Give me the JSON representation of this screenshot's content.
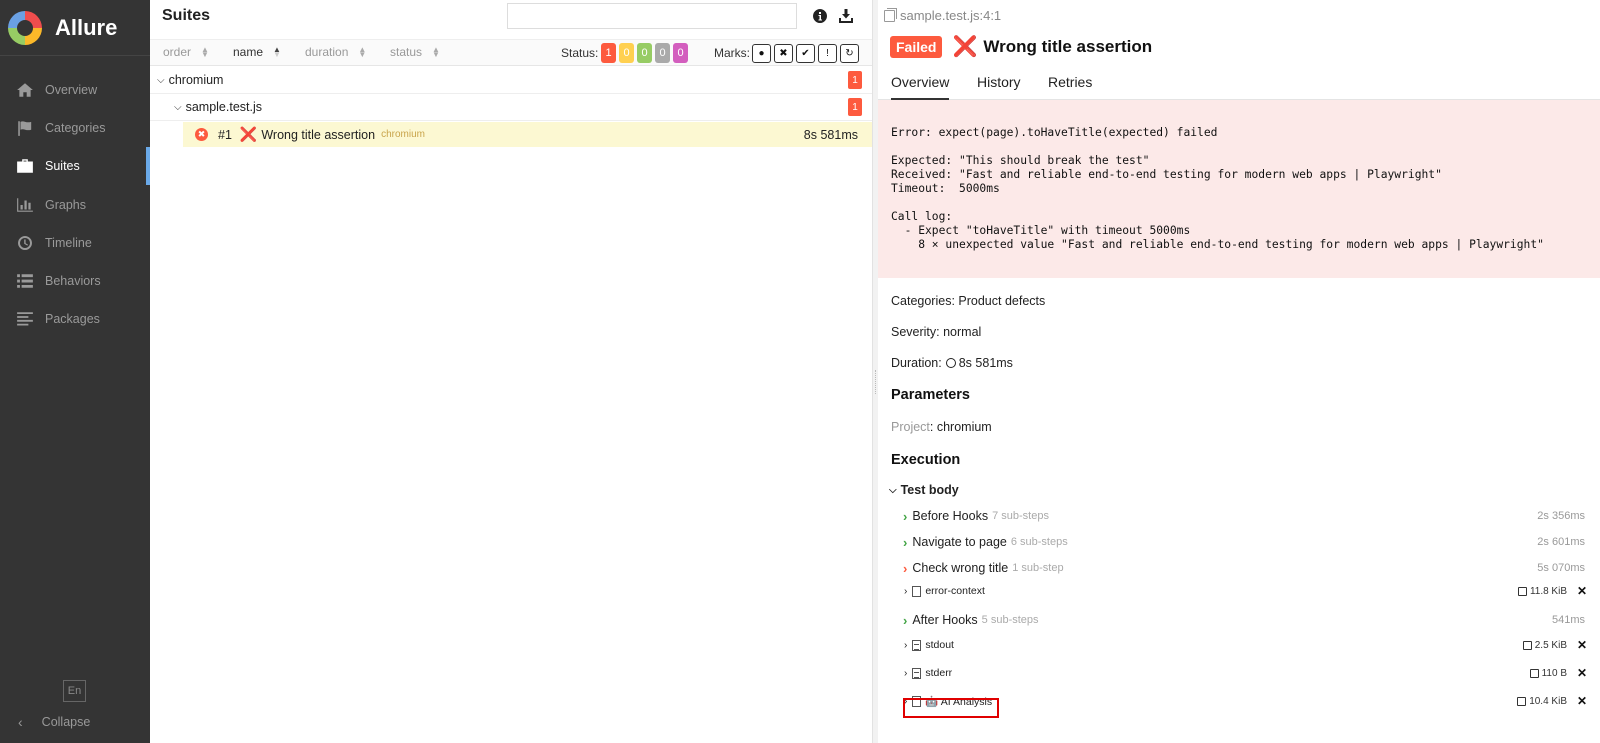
{
  "brand": {
    "name": "Allure"
  },
  "sidebar": {
    "items": [
      {
        "label": "Overview",
        "icon": "home-icon",
        "active": false
      },
      {
        "label": "Categories",
        "icon": "flag-icon",
        "active": false
      },
      {
        "label": "Suites",
        "icon": "briefcase-icon",
        "active": true
      },
      {
        "label": "Graphs",
        "icon": "bar-chart-icon",
        "active": false
      },
      {
        "label": "Timeline",
        "icon": "clock-icon",
        "active": false
      },
      {
        "label": "Behaviors",
        "icon": "list-icon",
        "active": false
      },
      {
        "label": "Packages",
        "icon": "align-left-icon",
        "active": false
      }
    ],
    "language": "En",
    "collapse_label": "Collapse"
  },
  "suites": {
    "title": "Suites",
    "search_value": "",
    "sort": {
      "order": "order",
      "name": "name",
      "duration": "duration",
      "status": "status"
    },
    "status_label": "Status:",
    "status_counts": [
      "1",
      "0",
      "0",
      "0",
      "0"
    ],
    "marks_label": "Marks:",
    "tree": {
      "group": "chromium",
      "group_count": "1",
      "file": "sample.test.js",
      "file_count": "1",
      "test": {
        "num": "#1",
        "name": "Wrong title assertion",
        "project": "chromium",
        "duration": "8s 581ms"
      }
    }
  },
  "detail": {
    "path": "sample.test.js:4:1",
    "status": "Failed",
    "title": "Wrong title assertion",
    "tabs": [
      "Overview",
      "History",
      "Retries"
    ],
    "error": "Error: expect(page).toHaveTitle(expected) failed\n\nExpected: \"This should break the test\"\nReceived: \"Fast and reliable end-to-end testing for modern web apps | Playwright\"\nTimeout:  5000ms\n\nCall log:\n  - Expect \"toHaveTitle\" with timeout 5000ms\n    8 × unexpected value \"Fast and reliable end-to-end testing for modern web apps | Playwright\"",
    "categories": "Categories: Product defects",
    "severity": "Severity: normal",
    "duration_label": "Duration:",
    "duration": "8s 581ms",
    "parameters_heading": "Parameters",
    "param_key": "Project",
    "param_value": ": chromium",
    "execution_heading": "Execution",
    "test_body_label": "Test body",
    "steps": [
      {
        "name": "Before Hooks",
        "sub": "7 sub-steps",
        "duration": "2s 356ms",
        "status": "passed"
      },
      {
        "name": "Navigate to page",
        "sub": "6 sub-steps",
        "duration": "2s 601ms",
        "status": "passed"
      },
      {
        "name": "Check wrong title",
        "sub": "1 sub-step",
        "duration": "5s 070ms",
        "status": "failed"
      }
    ],
    "error_context": {
      "name": "error-context",
      "size": "11.8 KiB"
    },
    "after_hooks": {
      "name": "After Hooks",
      "sub": "5 sub-steps",
      "duration": "541ms",
      "status": "passed"
    },
    "attachments": [
      {
        "name": "stdout",
        "size": "2.5 KiB"
      },
      {
        "name": "stderr",
        "size": "110 B"
      },
      {
        "name": "🤖 AI Analysis",
        "size": "10.4 KiB"
      }
    ]
  },
  "colors": {
    "failed": "#fd5a3e",
    "broken": "#ffd050",
    "passed": "#97cc64",
    "skipped": "#aaaaaa",
    "unknown": "#d35ebe",
    "sidebar_bg": "#343434",
    "error_bg": "#fce9e8",
    "selected_row": "#fcf8d2",
    "highlight": "#e00000"
  }
}
